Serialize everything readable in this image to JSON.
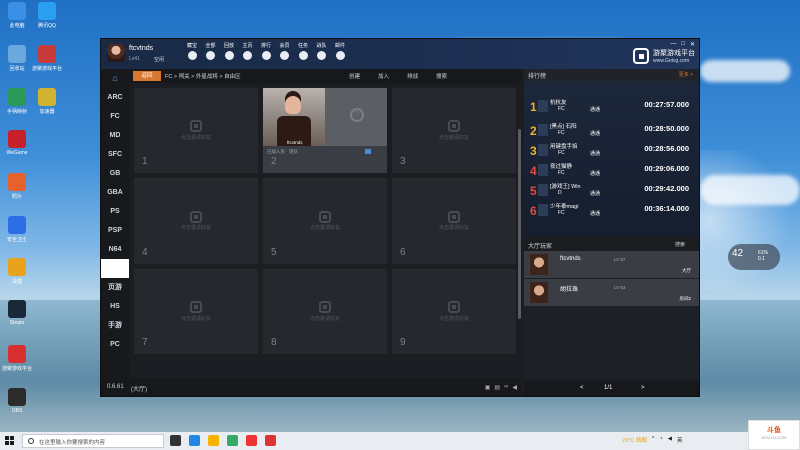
{
  "desktop": {
    "icons": [
      {
        "label": "此电脑",
        "color": "#3a8fe6"
      },
      {
        "label": "腾讯QQ",
        "color": "#2a9ff2"
      },
      {
        "label": "回收站",
        "color": "#6aa8de"
      },
      {
        "label": "游聚游戏平台",
        "color": "#c63a3a"
      },
      {
        "label": "手柄映射",
        "color": "#2b9a58"
      },
      {
        "label": "加速器",
        "color": "#d2b331"
      },
      {
        "label": "WeGame",
        "color": "#c8202a"
      },
      {
        "label": "照片",
        "color": "#e7622a"
      },
      {
        "label": "安全卫士",
        "color": "#2b6ee6"
      },
      {
        "label": "清理",
        "color": "#e8a21c"
      },
      {
        "label": "Steam",
        "color": "#1b2838"
      },
      {
        "label": "游聚游戏平台",
        "color": "#d83030"
      },
      {
        "label": "OBS",
        "color": "#2c2c2c"
      }
    ]
  },
  "app": {
    "user": {
      "name": "ftcvtnds",
      "level": "Lv41",
      "status": "空闲"
    },
    "nav": [
      "藏宝",
      "全部",
      "回放",
      "主页",
      "排行",
      "会员",
      "任务",
      "战队",
      "邮件"
    ],
    "brand": {
      "title": "游聚游戏平台",
      "url": "www.Gotvg.com"
    },
    "sidebar": [
      "⌂",
      "ARC",
      "FC",
      "MD",
      "SFC",
      "GB",
      "GBA",
      "PS",
      "PSP",
      "N64",
      "",
      "页游",
      "HS",
      "手游",
      "PC"
    ],
    "crumb": {
      "tab": "返回",
      "path": "FC > 闯关 > 外星战将 > 自由区"
    },
    "actions": [
      "创建",
      "加入",
      "排战",
      "搜索"
    ],
    "slots": [
      {
        "num": "1",
        "hint": "点击邀请好友"
      },
      {
        "num": "2",
        "player": "ftcvtnds",
        "meta": "已加入房 · 逐队"
      },
      {
        "num": "3",
        "hint": "点击邀请好友"
      },
      {
        "num": "4",
        "hint": "点击邀请好友"
      },
      {
        "num": "5",
        "hint": "点击邀请好友"
      },
      {
        "num": "6",
        "hint": "点击邀请好友"
      },
      {
        "num": "7",
        "hint": "点击邀请好友"
      },
      {
        "num": "8",
        "hint": "点击邀请好友"
      },
      {
        "num": "9",
        "hint": "点击邀请好友"
      }
    ],
    "status": {
      "version": "0.6.61",
      "hall": "(大厅)"
    },
    "rank": {
      "title": "排行榜",
      "more": "更多 >",
      "rows": [
        {
          "rank": "1",
          "name": "杭杭友",
          "platform": "FC",
          "tag": "通通",
          "time": "00:27:57.000"
        },
        {
          "rank": "2",
          "name": "[黑点] 石阳",
          "platform": "FC",
          "tag": "通通",
          "time": "00:28:50.000"
        },
        {
          "rank": "3",
          "name": "用键盘手掐",
          "platform": "FC",
          "tag": "通通",
          "time": "00:28:56.000"
        },
        {
          "rank": "4",
          "name": "夜过猫静",
          "platform": "FC",
          "tag": "通通",
          "time": "00:29:06.000"
        },
        {
          "rank": "5",
          "name": "[游戏王] Win",
          "platform": "D",
          "tag": "通通",
          "time": "00:29:42.000"
        },
        {
          "rank": "6",
          "name": "少年泰magi",
          "platform": "FC",
          "tag": "通通",
          "time": "00:36:14.000"
        }
      ]
    },
    "players": {
      "title": "大厅玩家",
      "search": "搜索",
      "rows": [
        {
          "name": "ftcvtnds",
          "level": "LV 87",
          "state": "大厅"
        },
        {
          "name": "胡拉珠",
          "level": "LV 53",
          "state": "房间2"
        }
      ]
    },
    "pager": {
      "prev": "<",
      "page": "1/1",
      "next": ">"
    }
  },
  "weather_widget": {
    "temp": "42",
    "detail1": "61%",
    "detail2": "0.1"
  },
  "taskbar": {
    "search_placeholder": "在这里输入你要搜索的内容",
    "weather": "23°C 晴朗",
    "app_colors": [
      "#333",
      "#1e88e5",
      "#f5b300",
      "#3a6",
      "#e33",
      "#d33"
    ]
  },
  "corner_logo": {
    "name": "斗鱼",
    "sub": "DOUYU.COM"
  }
}
